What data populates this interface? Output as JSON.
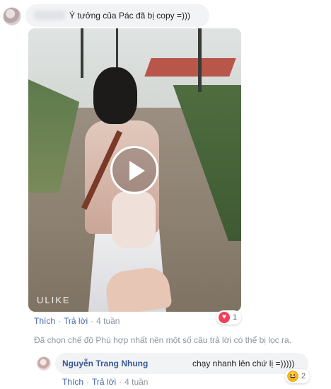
{
  "comment": {
    "text": "Ý tưởng của Pác đã bị copy =)))",
    "video": {
      "watermark": "ULIKE",
      "play_icon": "play-icon"
    },
    "actions": {
      "like": "Thích",
      "reply": "Trả lời",
      "time": "4 tuần",
      "separator": "·"
    },
    "reaction": {
      "icon": "heart-icon",
      "count": "1",
      "color": "#f33e58"
    }
  },
  "filter_note": "Đã chọn chế độ Phù hợp nhất nên một số câu trả lời có thể bị lọc ra.",
  "reply": {
    "author": "Nguyễn Trang Nhung",
    "text": "chạy nhanh lên chứ lị =)))))",
    "reaction": {
      "icon": "haha-icon",
      "count": "2",
      "color": "#f7b125"
    },
    "actions": {
      "like": "Thích",
      "reply": "Trả lời",
      "time": "4 tuần",
      "separator": "·"
    }
  },
  "colors": {
    "link": "#4267b2",
    "author": "#385898",
    "meta": "#8d949e",
    "bubble": "#f2f3f5"
  }
}
